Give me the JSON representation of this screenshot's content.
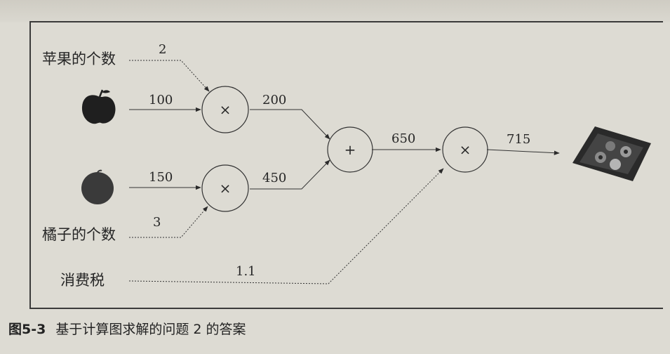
{
  "labels": {
    "apple_count": "苹果的个数",
    "orange_count": "橘子的个数",
    "tax": "消费税"
  },
  "values": {
    "apple_count": "2",
    "apple_price": "100",
    "apple_total": "200",
    "orange_price": "150",
    "orange_total": "450",
    "orange_count": "3",
    "sum": "650",
    "tax": "1.1",
    "result": "715"
  },
  "operators": {
    "mul_apple": "×",
    "mul_orange": "×",
    "add": "+",
    "mul_tax": "×"
  },
  "caption": {
    "figure_number": "图5-3",
    "text": "基于计算图求解的问题 2 的答案"
  },
  "colors": {
    "page": "#dddbd3",
    "ink": "#262626",
    "apple": "#1f1f1f",
    "orange": "#3a3a3a",
    "register": "#2a2a2a"
  }
}
